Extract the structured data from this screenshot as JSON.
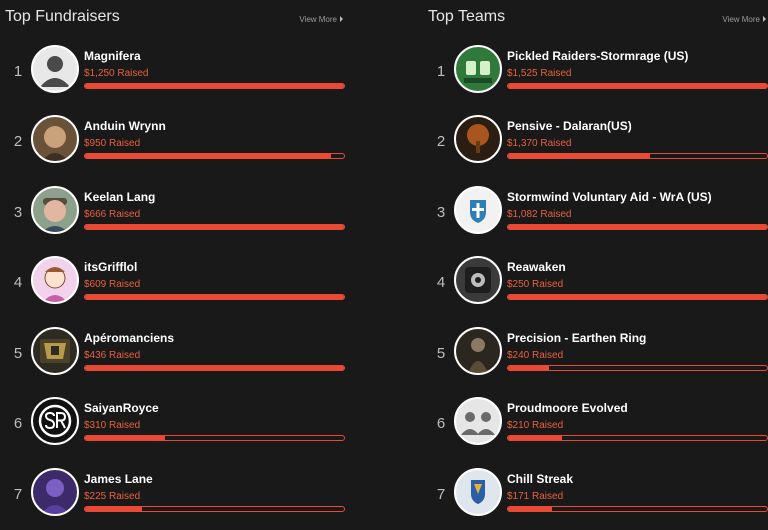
{
  "fundraisers": {
    "title": "Top Fundraisers",
    "view_more": "View More",
    "items": [
      {
        "rank": "1",
        "name": "Magnifera",
        "raised": "$1,250 Raised",
        "progress": 1.0,
        "avatar_icon": "default-user-icon"
      },
      {
        "rank": "2",
        "name": "Anduin Wrynn",
        "raised": "$950 Raised",
        "progress": 0.95,
        "avatar_icon": "portrait-icon"
      },
      {
        "rank": "3",
        "name": "Keelan Lang",
        "raised": "$666 Raised",
        "progress": 1.0,
        "avatar_icon": "portrait-icon"
      },
      {
        "rank": "4",
        "name": "itsGrifflol",
        "raised": "$609 Raised",
        "progress": 1.0,
        "avatar_icon": "cartoon-portrait-icon"
      },
      {
        "rank": "5",
        "name": "Apéromanciens",
        "raised": "$436 Raised",
        "progress": 1.0,
        "avatar_icon": "guild-emblem-icon"
      },
      {
        "rank": "6",
        "name": "SaiyanRoyce",
        "raised": "$310 Raised",
        "progress": 0.31,
        "avatar_icon": "sr-logo-icon"
      },
      {
        "rank": "7",
        "name": "James Lane",
        "raised": "$225 Raised",
        "progress": 0.22,
        "avatar_icon": "portrait-icon"
      }
    ]
  },
  "teams": {
    "title": "Top Teams",
    "view_more": "View More",
    "items": [
      {
        "rank": "1",
        "name": "Pickled Raiders-Stormrage (US)",
        "raised": "$1,525 Raised",
        "progress": 1.0,
        "avatar_icon": "team-logo-icon"
      },
      {
        "rank": "2",
        "name": "Pensive - Dalaran(US)",
        "raised": "$1,370 Raised",
        "progress": 0.55,
        "avatar_icon": "tree-emblem-icon"
      },
      {
        "rank": "3",
        "name": "Stormwind Voluntary Aid - WrA (US)",
        "raised": "$1,082 Raised",
        "progress": 1.0,
        "avatar_icon": "crest-icon"
      },
      {
        "rank": "4",
        "name": "Reawaken",
        "raised": "$250 Raised",
        "progress": 1.0,
        "avatar_icon": "shield-emblem-icon"
      },
      {
        "rank": "5",
        "name": "Precision - Earthen Ring",
        "raised": "$240 Raised",
        "progress": 0.16,
        "avatar_icon": "portrait-icon"
      },
      {
        "rank": "6",
        "name": "Proudmoore Evolved",
        "raised": "$210 Raised",
        "progress": 0.21,
        "avatar_icon": "group-icon"
      },
      {
        "rank": "7",
        "name": "Chill Streak",
        "raised": "$171 Raised",
        "progress": 0.17,
        "avatar_icon": "faction-crest-icon"
      }
    ]
  },
  "colors": {
    "accent": "#e84a35",
    "raised_text": "#e8603f",
    "background": "#1a1919"
  }
}
